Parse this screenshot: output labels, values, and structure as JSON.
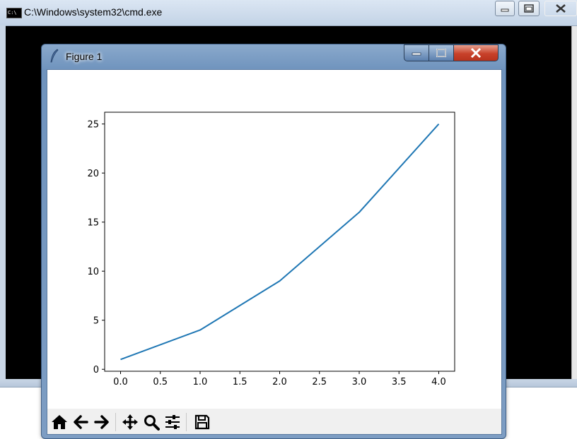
{
  "cmd_window": {
    "title": "C:\\Windows\\system32\\cmd.exe"
  },
  "figure_window": {
    "title": "Figure 1"
  },
  "toolbar": {
    "buttons": [
      "home-icon",
      "back-icon",
      "forward-icon",
      "pan-icon",
      "zoom-icon",
      "configure-subplots-icon",
      "save-icon"
    ]
  },
  "colors": {
    "line": "#1f77b4"
  },
  "chart_data": {
    "type": "line",
    "x": [
      0,
      1,
      2,
      3,
      4
    ],
    "series": [
      {
        "values": [
          1,
          4,
          9,
          16,
          25
        ]
      }
    ],
    "xlim": [
      -0.2,
      4.2
    ],
    "ylim": [
      -0.2,
      26.2
    ],
    "xticks": [
      "0.0",
      "0.5",
      "1.0",
      "1.5",
      "2.0",
      "2.5",
      "3.0",
      "3.5",
      "4.0"
    ],
    "yticks": [
      "0",
      "5",
      "10",
      "15",
      "20",
      "25"
    ],
    "grid": false
  }
}
